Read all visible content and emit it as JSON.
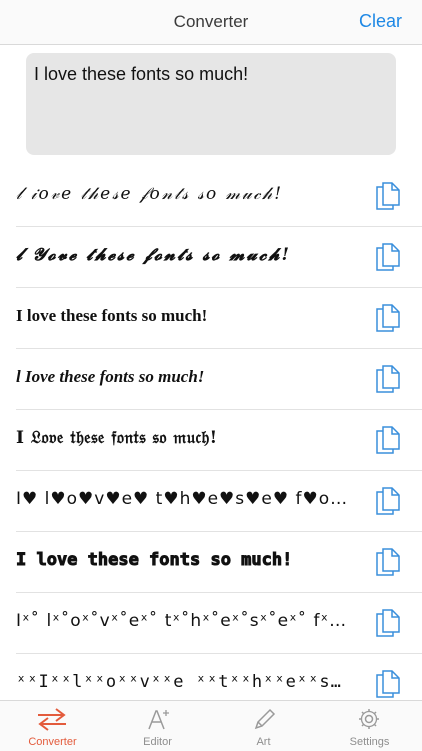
{
  "header": {
    "title": "Converter",
    "clear_label": "Clear"
  },
  "input": {
    "text": "I love these fonts so much!"
  },
  "results": [
    {
      "text": "𝓁 𝒾𝑜𝓋𝑒 𝓉𝒽𝑒𝓈𝑒 𝒻𝑜𝓃𝓉𝓈 𝓈𝑜 𝓂𝓊𝒸𝒽!"
    },
    {
      "text": "𝓵 𝓨𝓸𝓿𝓮 𝓽𝓱𝓮𝓼𝓮 𝓯𝓸𝓷𝓽𝓼 𝓼𝓸 𝓶𝓾𝓬𝓱!"
    },
    {
      "text": "I love these fonts so much!"
    },
    {
      "text": "l Iove these fonts so much!"
    },
    {
      "text": "I 𝔏𝔬𝔳𝔢 𝔱𝔥𝔢𝔰𝔢 𝔣𝔬𝔫𝔱𝔰 𝔰𝔬 𝔪𝔲𝔠𝔥!"
    },
    {
      "text": "I♥ l♥o♥v♥e♥ t♥h♥e♥s♥e♥ f♥o♥n..."
    },
    {
      "text": "I love these fonts so much!"
    },
    {
      "text": "Iˣ˚ lˣ˚oˣ˚vˣ˚eˣ˚ tˣ˚hˣ˚eˣ˚sˣ˚eˣ˚ fˣ˚oˣ˚nˣ˚tˣ˚..."
    },
    {
      "text": "ˣˣIˣˣlˣˣoˣˣvˣˣe ˣˣtˣˣhˣˣeˣˣsˣˣe ˣˣfˣˣoˣˣnˣˣt..."
    }
  ],
  "tabs": [
    {
      "label": "Converter",
      "icon": "swap-arrows-icon",
      "active": true
    },
    {
      "label": "Editor",
      "icon": "text-editor-icon",
      "active": false
    },
    {
      "label": "Art",
      "icon": "pencil-icon",
      "active": false
    },
    {
      "label": "Settings",
      "icon": "gear-icon",
      "active": false
    }
  ],
  "colors": {
    "accent": "#1e88e5",
    "active_tab": "#e35b3c",
    "input_bg": "#e6e6e6"
  }
}
